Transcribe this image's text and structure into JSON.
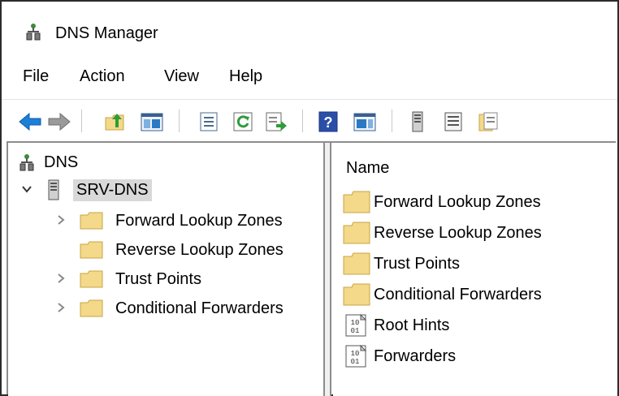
{
  "window": {
    "title": "DNS Manager"
  },
  "menu": [
    "File",
    "Action",
    "View",
    "Help"
  ],
  "toolbar": {
    "buttons": [
      "back",
      "forward",
      "up-folder",
      "show-hide-console-tree",
      "properties",
      "refresh",
      "export-list",
      "help",
      "show-hide-action-pane",
      "server",
      "list",
      "zone"
    ]
  },
  "tree": {
    "root": {
      "label": "DNS",
      "icon": "dns-icon"
    },
    "server": {
      "label": "SRV-DNS",
      "icon": "server-icon",
      "expanded": true,
      "selected": true
    },
    "children": [
      {
        "label": "Forward Lookup Zones",
        "icon": "folder-icon",
        "expandable": true
      },
      {
        "label": "Reverse Lookup Zones",
        "icon": "folder-icon",
        "expandable": false
      },
      {
        "label": "Trust Points",
        "icon": "folder-icon",
        "expandable": true
      },
      {
        "label": "Conditional Forwarders",
        "icon": "folder-icon",
        "expandable": true
      }
    ]
  },
  "list": {
    "column": "Name",
    "items": [
      {
        "label": "Forward Lookup Zones",
        "icon": "folder-icon"
      },
      {
        "label": "Reverse Lookup Zones",
        "icon": "folder-icon"
      },
      {
        "label": "Trust Points",
        "icon": "folder-icon"
      },
      {
        "label": "Conditional Forwarders",
        "icon": "folder-icon"
      },
      {
        "label": "Root Hints",
        "icon": "binary-file-icon"
      },
      {
        "label": "Forwarders",
        "icon": "binary-file-icon"
      }
    ]
  },
  "colors": {
    "folder": "#f3d989",
    "folder_stroke": "#c9a445",
    "selection": "#d9d9d9",
    "arrow_back": "#1e7fd6"
  }
}
